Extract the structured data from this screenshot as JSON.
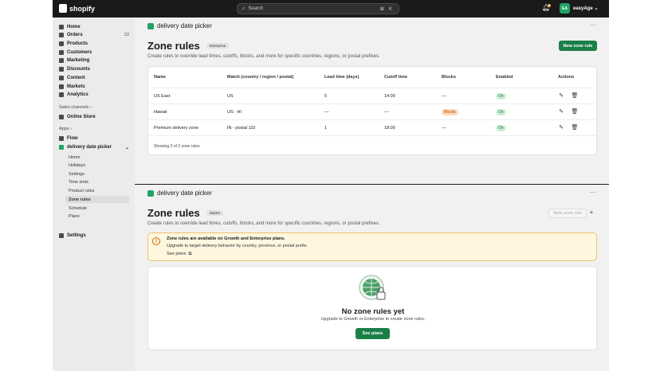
{
  "topbar": {
    "brand": "shopify",
    "search_placeholder": "Search",
    "shortcut": "⌘ K",
    "avatar_initials": "EA",
    "store_name": "easyAge"
  },
  "sidebar": {
    "items": [
      {
        "label": "Home"
      },
      {
        "label": "Orders",
        "count": "23"
      },
      {
        "label": "Products"
      },
      {
        "label": "Customers"
      },
      {
        "label": "Marketing"
      },
      {
        "label": "Discounts"
      },
      {
        "label": "Content"
      },
      {
        "label": "Markets"
      },
      {
        "label": "Analytics"
      }
    ],
    "sales_channels_label": "Sales channels",
    "online_store": "Online Store",
    "apps_label": "Apps",
    "flow": "Flow",
    "app_name": "delivery date picker",
    "sub_items": [
      "Home",
      "Holidays",
      "Settings",
      "Time slots",
      "Product rules",
      "Zone rules",
      "Schedule",
      "Plans"
    ],
    "settings": "Settings"
  },
  "enterprise": {
    "app_name": "delivery date picker",
    "title": "Zone rules",
    "plan_badge": "Enterprise",
    "description": "Create rules to override lead times, cutoffs, blocks, and more for specific countries, regions, or postal prefixes.",
    "new_button": "New zone rule",
    "columns": [
      "Name",
      "Match (country / region / postal)",
      "Lead time (days)",
      "Cutoff time",
      "Blocks",
      "Enabled",
      "Actions"
    ],
    "rows": [
      {
        "name": "US East",
        "match": "US",
        "lead": "5",
        "cutoff": "14:00",
        "blocks": "—",
        "enabled": "On"
      },
      {
        "name": "Hawaii",
        "match": "US - HI",
        "lead": "—",
        "cutoff": "—",
        "blocks": "Blocks",
        "enabled": "On"
      },
      {
        "name": "Premium delivery zone",
        "match": "IN - postal 110",
        "lead": "1",
        "cutoff": "18:00",
        "blocks": "—",
        "enabled": "On"
      }
    ],
    "footer": "Showing 3 of 3 zone rules"
  },
  "starter": {
    "app_name": "delivery date picker",
    "title": "Zone rules",
    "plan_badge": "Starter",
    "description": "Create rules to override lead times, cutoffs, blocks, and more for specific countries, regions, or postal prefixes.",
    "new_button": "New zone rule",
    "banner_title": "Zone rules are available on Growth and Enterprise plans.",
    "banner_text": "Upgrade to target delivery behavior by country, province, or postal prefix.",
    "banner_link": "See plans",
    "empty_title": "No zone rules yet",
    "empty_text": "Upgrade to Growth or Enterprise to create zone rules.",
    "cta": "See plans"
  },
  "colors": {
    "topbar": "#1a1a1a",
    "primary": "#1a7f47",
    "on_badge": "#cfeed8",
    "blocks_badge": "#fcdcc0",
    "banner_bg": "#fff6e0"
  }
}
